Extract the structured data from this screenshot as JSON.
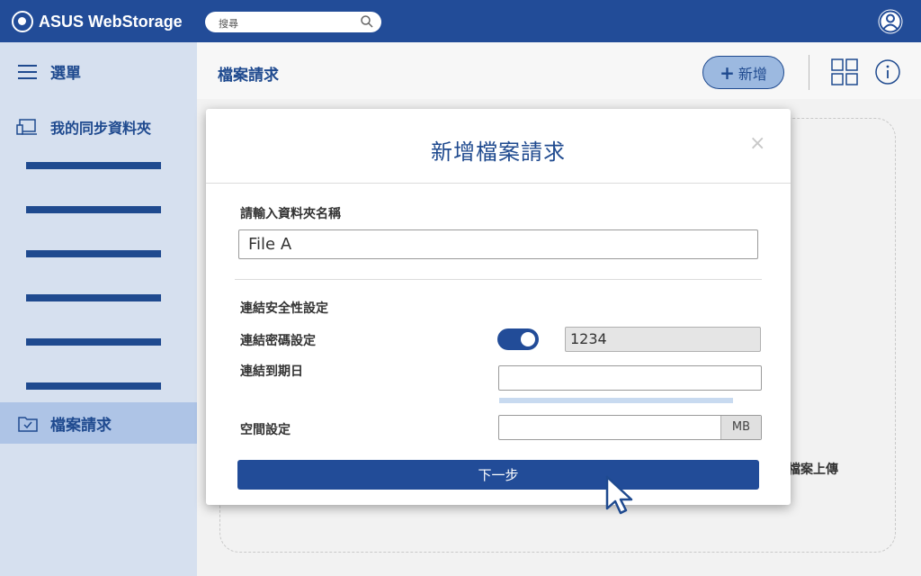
{
  "app": {
    "title": "ASUS WebStorage"
  },
  "search": {
    "placeholder": "搜尋"
  },
  "sidebar": {
    "menu_label": "選單",
    "sync_label": "我的同步資料夾",
    "active_label": "檔案請求"
  },
  "header": {
    "title": "檔案請求",
    "new_button": "新增"
  },
  "background": {
    "drop_text": "檔案上傳"
  },
  "modal": {
    "title": "新增檔案請求",
    "close": "×",
    "folder_name_label": "請輸入資料夾名稱",
    "folder_name_value": "File A",
    "security_label": "連結安全性設定",
    "password_label": "連結密碼設定",
    "password_toggle": "on",
    "password_value": "1234",
    "expiry_label": "連結到期日",
    "space_label": "空間設定",
    "space_unit": "MB",
    "next_button": "下一步"
  },
  "colors": {
    "brand": "#224c98",
    "sidebar_bg": "#d6e0ef",
    "sidebar_active": "#aec4e6"
  }
}
